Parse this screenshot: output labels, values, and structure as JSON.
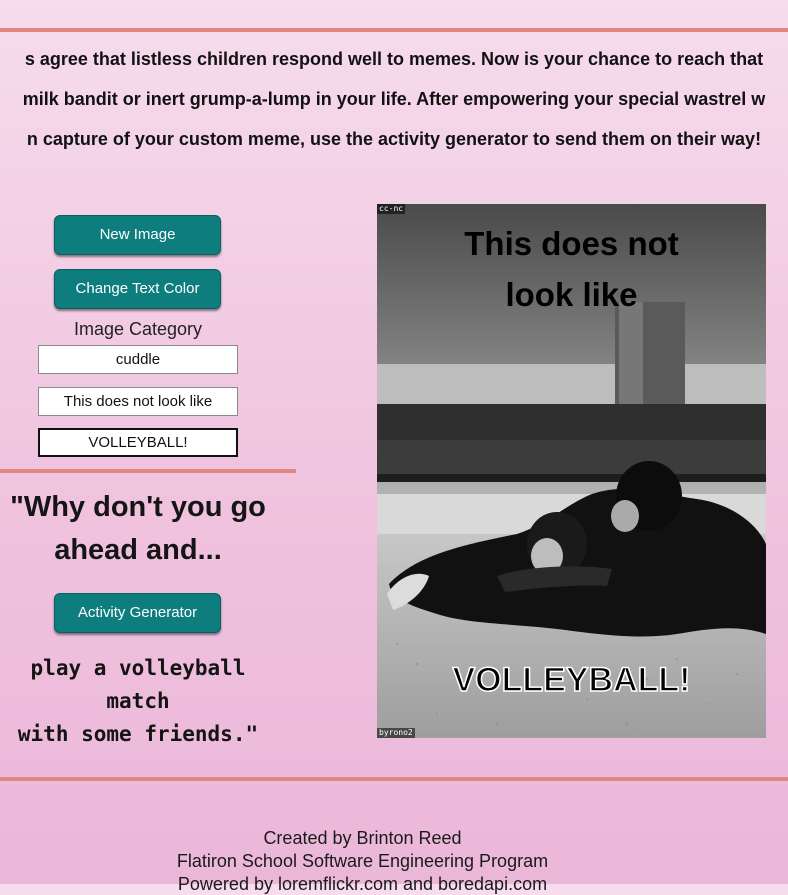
{
  "intro": {
    "line1": "s agree that listless children respond well to memes. Now is your chance to reach that",
    "line2": "milk bandit or inert grump-a-lump in your life. After empowering your special wastrel w",
    "line3": "n capture of your custom meme, use the activity generator to send them on their way!"
  },
  "controls": {
    "new_image_label": "New Image",
    "change_text_color_label": "Change Text Color",
    "category_label": "Image Category",
    "category_value": "cuddle",
    "top_text_value": "This does not look like",
    "bottom_text_value": "VOLLEYBALL!"
  },
  "activity": {
    "quote_line1": "\"Why don't you go",
    "quote_line2": "ahead and...",
    "generator_label": "Activity Generator",
    "activity_line1": "play a volleyball match",
    "activity_line2": "with some friends.\""
  },
  "meme": {
    "top_line1": "This does not",
    "top_line2": "look like",
    "bottom_text": "VOLLEYBALL!",
    "license_tag": "cc-nc",
    "author_tag": "byrono2"
  },
  "footer": {
    "line1": "Created by Brinton Reed",
    "line2": "Flatiron School Software Engineering Program",
    "line3": "Powered by loremflickr.com and boredapi.com"
  },
  "colors": {
    "accent_rule": "#e0887e",
    "button_teal": "#0d7d7e",
    "background_top": "#f6dcec",
    "background_bottom": "#ebb7d9"
  }
}
